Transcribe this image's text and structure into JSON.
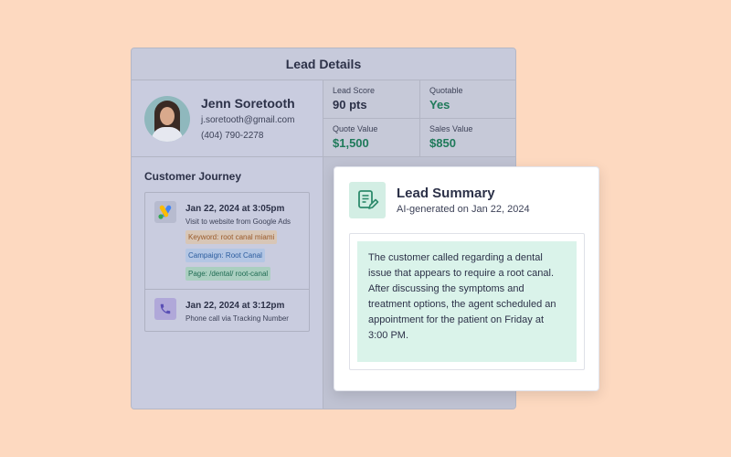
{
  "panel": {
    "title": "Lead Details"
  },
  "contact": {
    "name": "Jenn Soretooth",
    "email": "j.soretooth@gmail.com",
    "phone": "(404) 790-2278"
  },
  "stats": [
    {
      "label": "Lead Score",
      "value": "90 pts"
    },
    {
      "label": "Quotable",
      "value": "Yes"
    },
    {
      "label": "Quote Value",
      "value": "$1,500"
    },
    {
      "label": "Sales Value",
      "value": "$850"
    }
  ],
  "journey": {
    "title": "Customer Journey",
    "events": [
      {
        "icon": "google-ads-icon",
        "time": "Jan 22, 2024 at 3:05pm",
        "desc": "Visit to website from Google Ads",
        "tags": [
          "Keyword:  root canal miami",
          "Campaign:  Root Canal",
          "Page: /dental/  root-canal"
        ]
      },
      {
        "icon": "phone-icon",
        "time": "Jan 22, 2024 at 3:12pm",
        "desc": "Phone call via Tracking Number"
      }
    ]
  },
  "summary": {
    "title": "Lead Summary",
    "subtitle": "AI-generated on Jan 22, 2024",
    "text": "The customer called regarding a dental issue that appears to require a root canal.  After discussing the symptoms and treatment options, the agent scheduled an appointment for the patient on Friday at 3:00 PM."
  },
  "colors": {
    "background": "#fdd9c0",
    "accent_green": "#1f7a5a",
    "summary_highlight": "#daf3ea"
  }
}
